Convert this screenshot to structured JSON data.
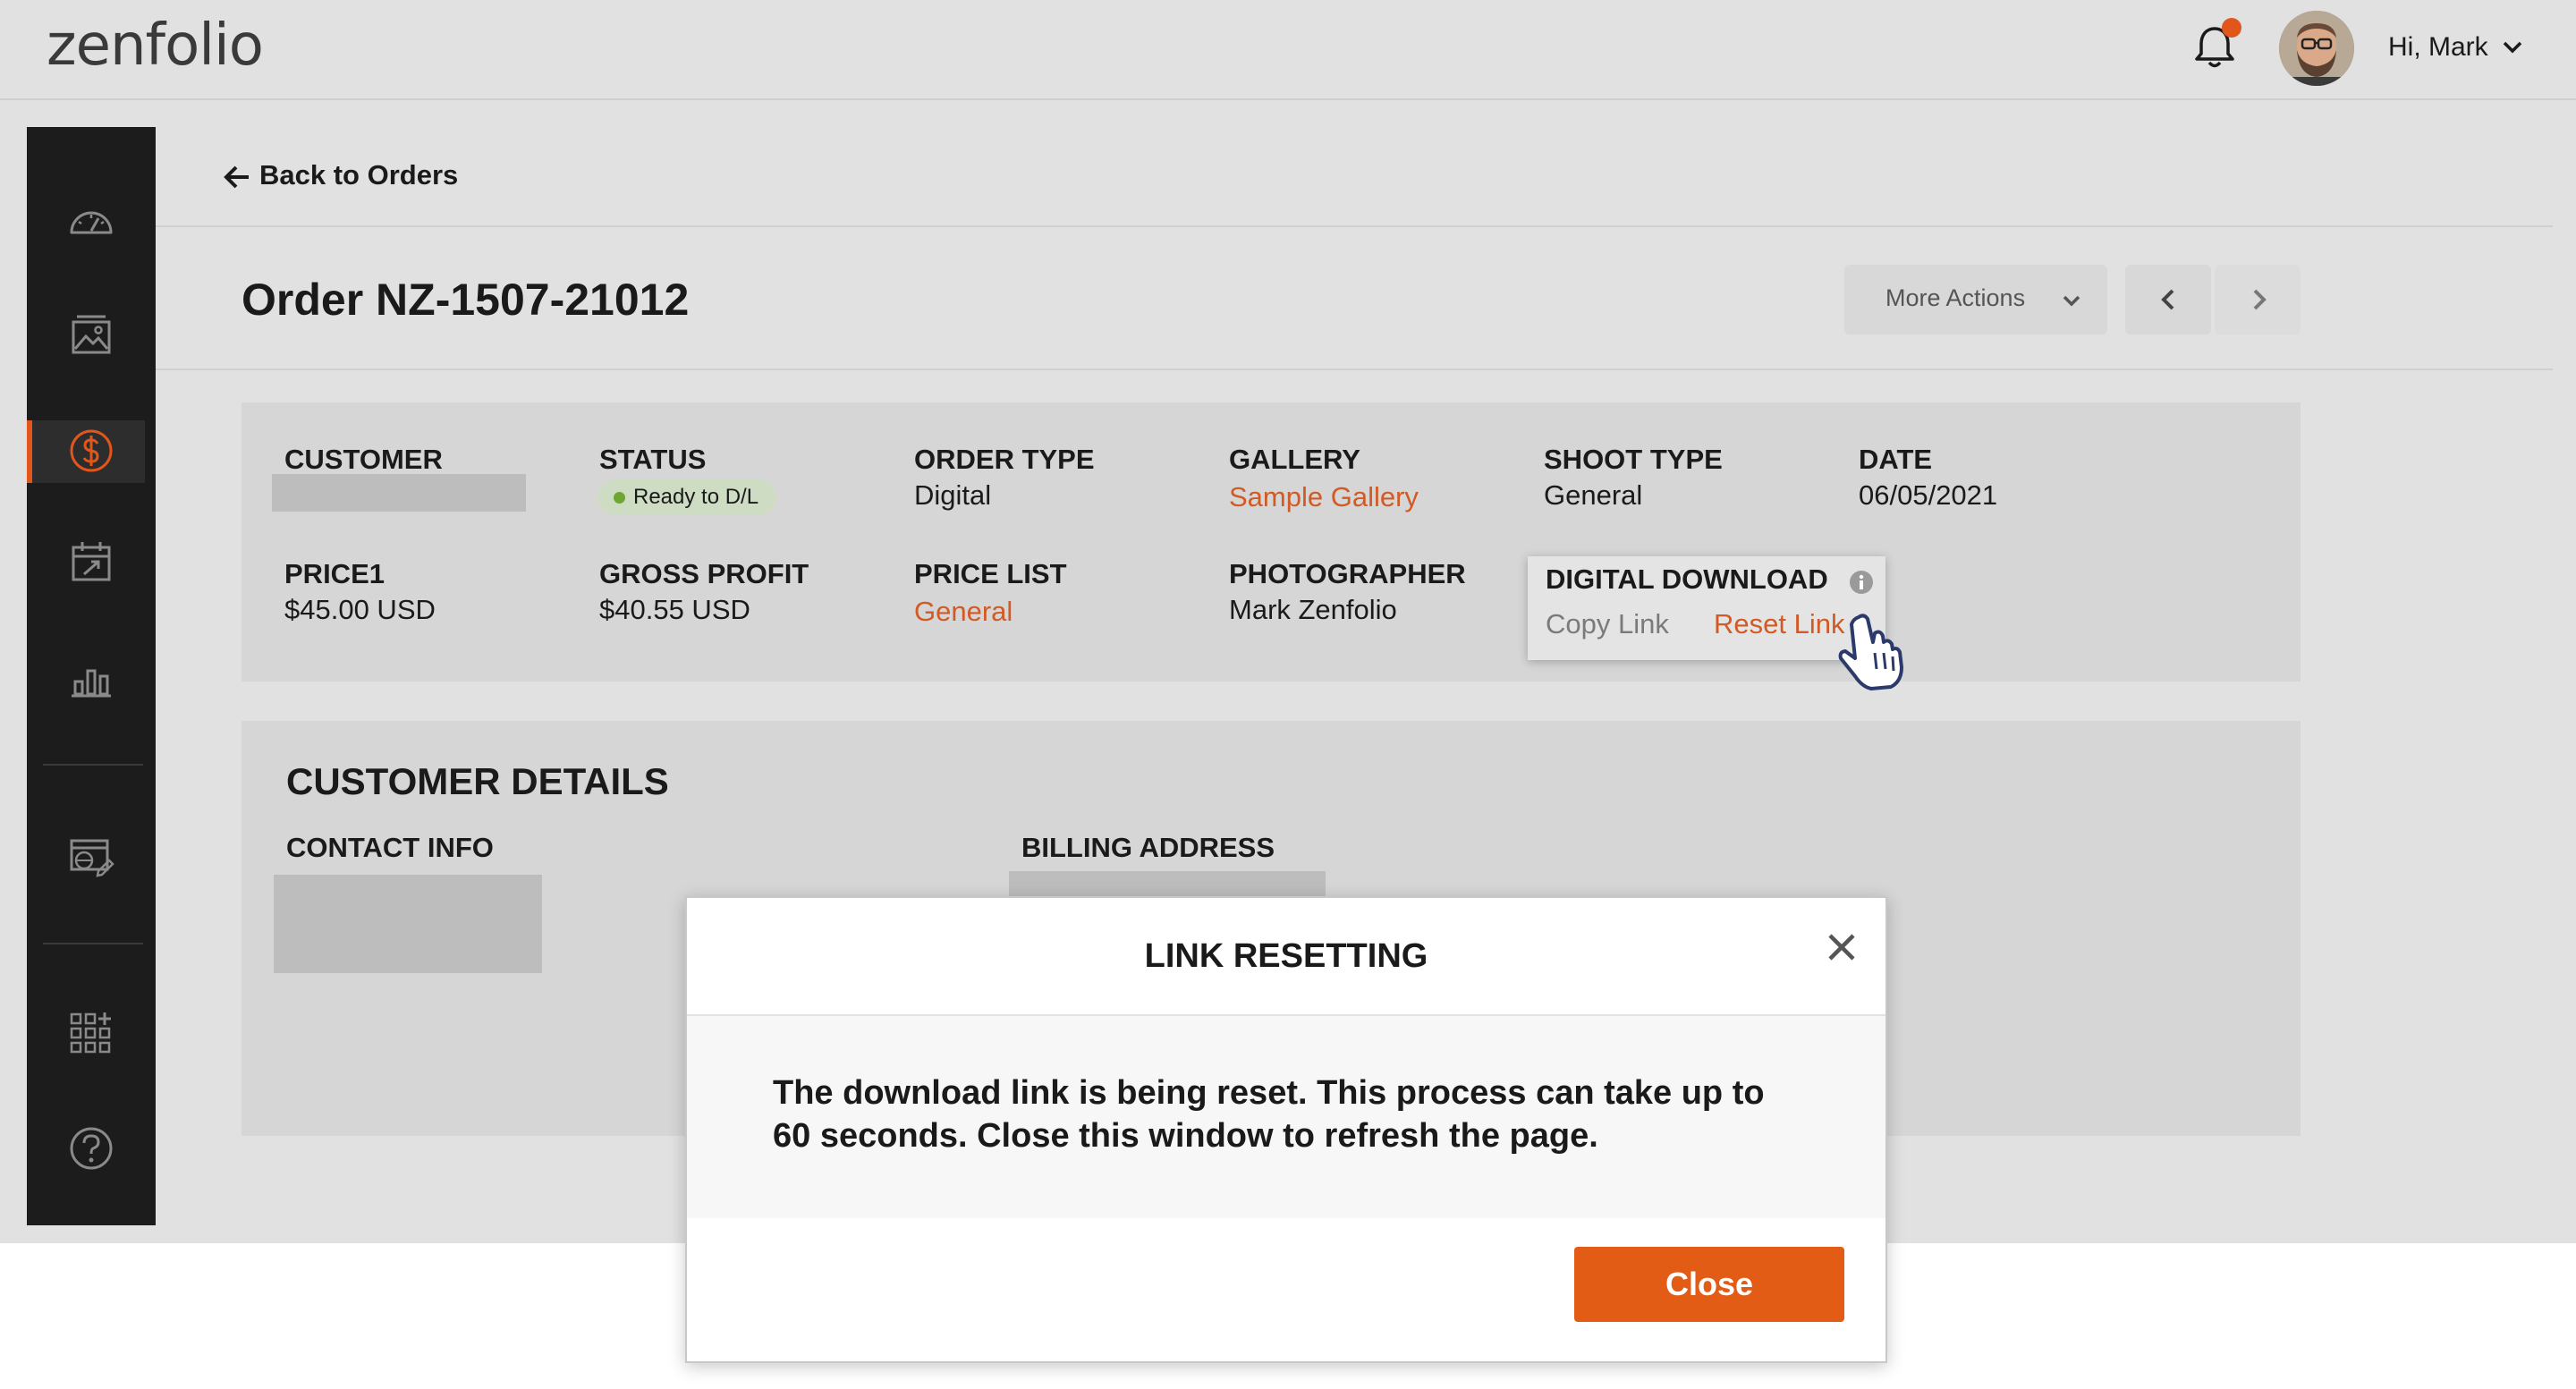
{
  "app": {
    "logo_text": "zenfolio",
    "greeting": "Hi, Mark"
  },
  "colors": {
    "accent": "#e0561b",
    "link": "#d25a24",
    "sidebar": "#1c1c1c",
    "status_green": "#6da632"
  },
  "sidebar": {
    "items": [
      {
        "name": "dashboard",
        "icon": "speedometer-icon",
        "active": false
      },
      {
        "name": "galleries",
        "icon": "image-icon",
        "active": false
      },
      {
        "name": "sales",
        "icon": "dollar-icon",
        "active": true
      },
      {
        "name": "planner",
        "icon": "calendar-icon",
        "active": false
      },
      {
        "name": "reports",
        "icon": "bar-chart-icon",
        "active": false
      },
      {
        "name": "website",
        "icon": "website-edit-icon",
        "active": false
      },
      {
        "name": "apps",
        "icon": "grid-plus-icon",
        "active": false
      },
      {
        "name": "help",
        "icon": "help-icon",
        "active": false
      }
    ]
  },
  "nav": {
    "back_label": "Back to Orders"
  },
  "order": {
    "title": "Order NZ-1507-21012",
    "more_actions": "More Actions"
  },
  "summary": {
    "customer_label": "CUSTOMER",
    "status_label": "STATUS",
    "status_value": "Ready to D/L",
    "order_type_label": "ORDER TYPE",
    "order_type_value": "Digital",
    "gallery_label": "GALLERY",
    "gallery_value": "Sample Gallery",
    "shoot_type_label": "SHOOT TYPE",
    "shoot_type_value": "General",
    "date_label": "DATE",
    "date_value": "06/05/2021",
    "price_label": "PRICE1",
    "price_value": "$45.00 USD",
    "gross_profit_label": "GROSS PROFIT",
    "gross_profit_value": "$40.55 USD",
    "price_list_label": "PRICE LIST",
    "price_list_value": "General",
    "photographer_label": "PHOTOGRAPHER",
    "photographer_value": "Mark Zenfolio",
    "digital_download_label": "DIGITAL DOWNLOAD",
    "copy_link": "Copy Link",
    "reset_link": "Reset Link"
  },
  "details": {
    "title": "CUSTOMER DETAILS",
    "contact_label": "CONTACT INFO",
    "billing_label": "BILLING ADDRESS"
  },
  "modal": {
    "title": "LINK RESETTING",
    "message": "The download link is being reset. This process can take up to 60 seconds. Close this window to refresh the page.",
    "close_button": "Close"
  }
}
